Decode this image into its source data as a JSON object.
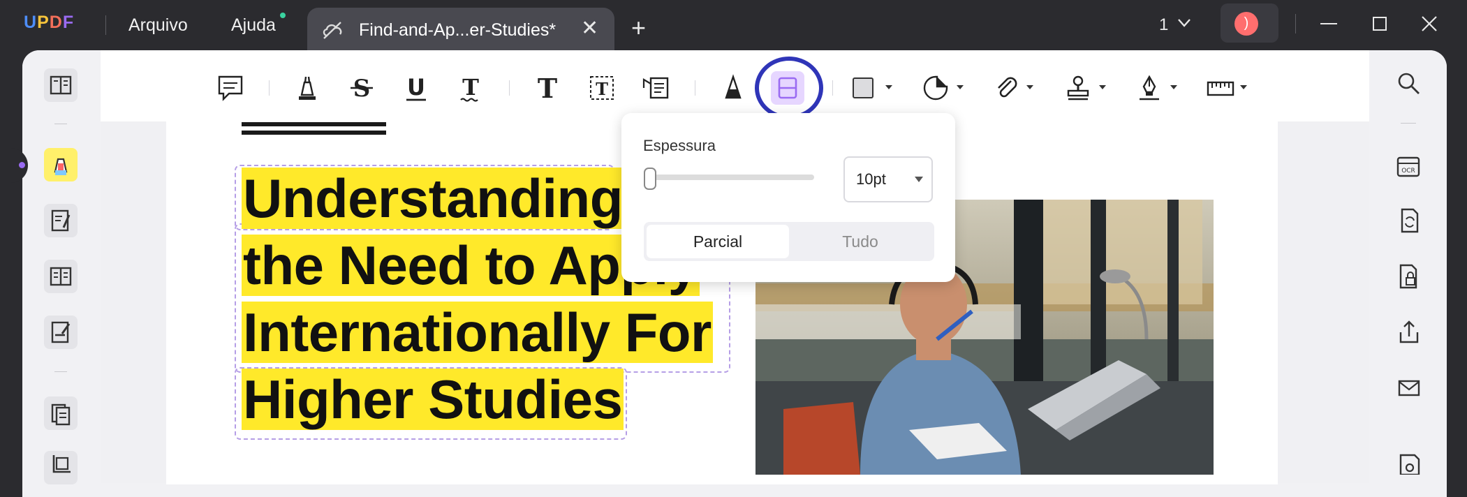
{
  "app": {
    "logo_letters": [
      "U",
      "P",
      "D",
      "F"
    ],
    "logo_colors": [
      "#4e8df7",
      "#f6c43b",
      "#f36f5a",
      "#9a6bf2"
    ]
  },
  "menu": {
    "file": "Arquivo",
    "help": "Ajuda"
  },
  "tab": {
    "title": "Find-and-Ap...er-Studies*"
  },
  "header": {
    "page_indicator": "1",
    "avatar_initial": ")"
  },
  "colors": {
    "highlight": "#ffe92a",
    "selected_tool": "#e6d6ff",
    "annotation_circle": "#2f35b8",
    "accent_purple": "#9a6bf2"
  },
  "toolbar_tools": [
    "comment-icon",
    "highlight-icon",
    "strikethrough-icon",
    "underline-icon",
    "squiggly-icon",
    "text-icon",
    "textbox-icon",
    "text-callout-icon",
    "pencil-icon",
    "eraser-icon",
    "rectangle-shape-icon",
    "sticker-icon",
    "attachment-icon",
    "stamp-icon",
    "signature-icon",
    "measure-icon"
  ],
  "eraser_popup": {
    "thickness_label": "Espessura",
    "thickness_value": "10pt",
    "slider_level": 0.0,
    "mode_options": [
      "Parcial",
      "Tudo"
    ],
    "selected_mode": "Parcial"
  },
  "document": {
    "heading_lines": [
      "Understanding",
      "the Need to Apply",
      "Internationally For",
      "Higher Studies"
    ]
  },
  "left_sidebar": [
    "reader-icon",
    "comment-mode-icon",
    "edit-pdf-icon",
    "form-icon",
    "sign-icon",
    "organize-pages-icon",
    "crop-icon"
  ],
  "right_sidebar": [
    "search-icon",
    "ocr-icon",
    "convert-icon",
    "protect-icon",
    "share-icon",
    "email-icon",
    "save-icon"
  ]
}
